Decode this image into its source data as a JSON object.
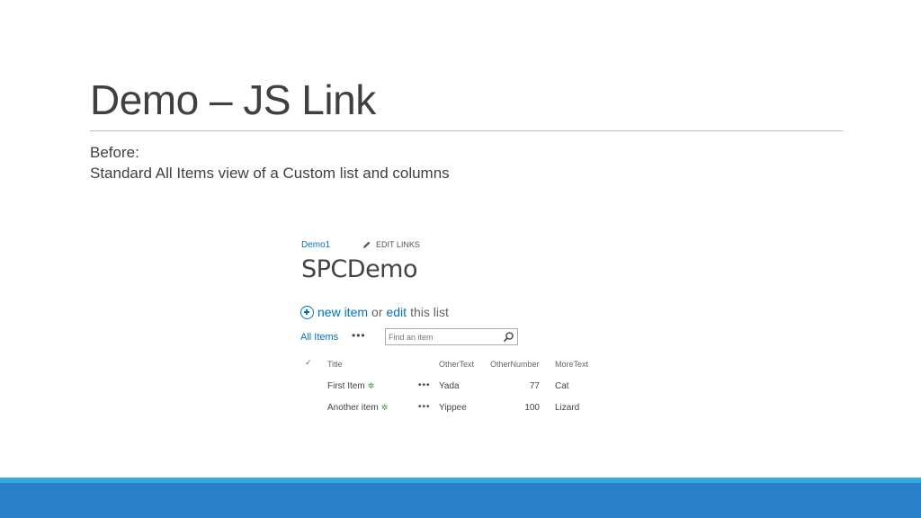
{
  "slide": {
    "title": "Demo – JS Link",
    "subtitle_line1": "Before:",
    "subtitle_line2": "Standard All Items view of a Custom list and columns"
  },
  "sharepoint": {
    "breadcrumb": "Demo1",
    "edit_links": "EDIT LINKS",
    "site_title": "SPCDemo",
    "new_item_link": "new item",
    "or_text": "or",
    "edit_link": "edit",
    "this_list_text": "this list",
    "view_label": "All Items",
    "view_more": "•••",
    "search": {
      "placeholder": "Find an item",
      "value": ""
    },
    "columns": {
      "check": "✓",
      "title": "Title",
      "other_text": "OtherText",
      "other_number": "OtherNumber",
      "more_text": "MoreText"
    },
    "rows": [
      {
        "title": "First Item",
        "new_badge": "✲",
        "menu": "•••",
        "other_text": "Yada",
        "other_number": "77",
        "more_text": "Cat"
      },
      {
        "title": "Another item",
        "new_badge": "✲",
        "menu": "•••",
        "other_text": "Yippee",
        "other_number": "100",
        "more_text": "Lizard"
      }
    ]
  },
  "colors": {
    "link_blue": "#0072c6",
    "new_badge_green": "#2e9e2e",
    "footer_stripe": "#34aadf",
    "footer_band": "#2a7fc8"
  }
}
